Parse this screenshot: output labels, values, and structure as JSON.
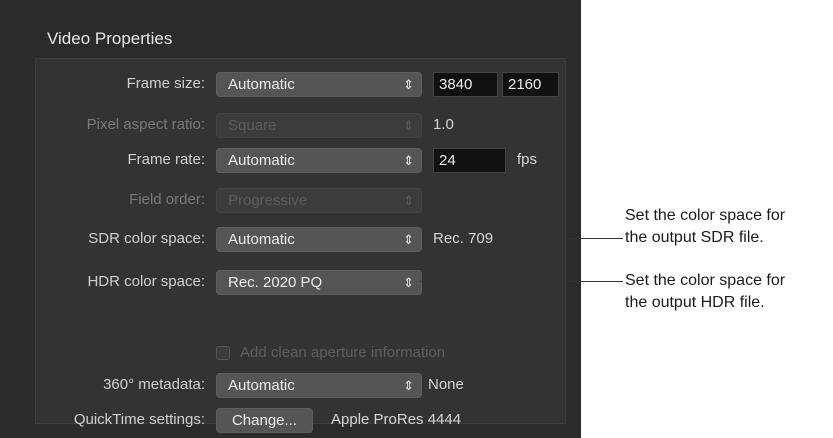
{
  "panel": {
    "title": "Video Properties"
  },
  "rows": {
    "frame_size": {
      "label": "Frame size:",
      "value": "Automatic",
      "width": "3840",
      "height": "2160"
    },
    "pixel_aspect": {
      "label": "Pixel aspect ratio:",
      "value": "Square",
      "readout": "1.0"
    },
    "frame_rate": {
      "label": "Frame rate:",
      "value": "Automatic",
      "fps_value": "24",
      "fps_unit": "fps"
    },
    "field_order": {
      "label": "Field order:",
      "value": "Progressive"
    },
    "sdr": {
      "label": "SDR color space:",
      "value": "Automatic",
      "readout": "Rec. 709"
    },
    "hdr": {
      "label": "HDR color space:",
      "value": "Rec. 2020 PQ"
    },
    "clean_aperture": {
      "label": "Add clean aperture information",
      "checked": false
    },
    "metadata360": {
      "label": "360° metadata:",
      "value": "Automatic",
      "readout": "None"
    },
    "quicktime": {
      "label": "QuickTime settings:",
      "button": "Change...",
      "readout": "Apple ProRes 4444"
    }
  },
  "callouts": {
    "sdr": {
      "line1": "Set the color space for",
      "line2": "the output SDR file."
    },
    "hdr": {
      "line1": "Set the color space for",
      "line2": "the output HDR file."
    }
  },
  "icons": {
    "popup_chevron": "up-down-chevron-icon"
  },
  "colors": {
    "panel_bg": "#2b2b2b",
    "popup_bg": "#555555",
    "field_bg": "#111111"
  }
}
